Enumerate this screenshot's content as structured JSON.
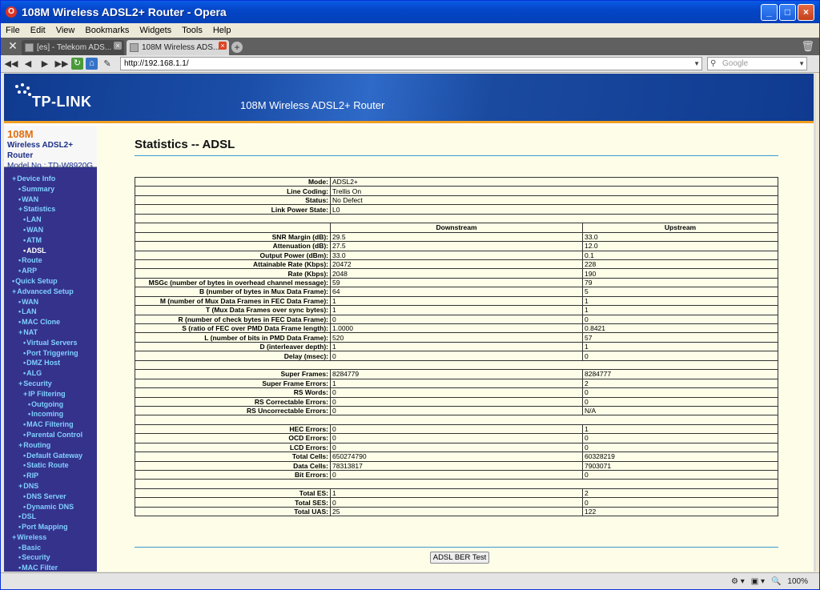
{
  "window": {
    "title": "108M Wireless ADSL2+ Router - Opera",
    "controls": [
      "_",
      "□",
      "×"
    ]
  },
  "menubar": [
    "File",
    "Edit",
    "View",
    "Bookmarks",
    "Widgets",
    "Tools",
    "Help"
  ],
  "tabs": [
    {
      "label": "[es] - Telekom ADS..."
    },
    {
      "label": "108M Wireless ADS..."
    }
  ],
  "address": {
    "url": "http://192.168.1.1/",
    "search_placeholder": "Google"
  },
  "banner": {
    "logo": "TP-LINK",
    "title": "108M Wireless ADSL2+ Router"
  },
  "model": {
    "line1": "108M",
    "line2": "Wireless ADSL2+ Router",
    "line3": "Model No.: TD-W8920G"
  },
  "menu": [
    {
      "label": "Device Info",
      "level": 0,
      "bullet": "+"
    },
    {
      "label": "Summary",
      "level": 1,
      "bullet": "•"
    },
    {
      "label": "WAN",
      "level": 1,
      "bullet": "•"
    },
    {
      "label": "Statistics",
      "level": 1,
      "bullet": "+"
    },
    {
      "label": "LAN",
      "level": 2,
      "bullet": "•"
    },
    {
      "label": "WAN",
      "level": 2,
      "bullet": "•"
    },
    {
      "label": "ATM",
      "level": 2,
      "bullet": "•"
    },
    {
      "label": "ADSL",
      "level": 2,
      "bullet": "•",
      "active": true
    },
    {
      "label": "Route",
      "level": 1,
      "bullet": "•"
    },
    {
      "label": "ARP",
      "level": 1,
      "bullet": "•"
    },
    {
      "label": "Quick Setup",
      "level": 0,
      "bullet": "•"
    },
    {
      "label": "Advanced Setup",
      "level": 0,
      "bullet": "+"
    },
    {
      "label": "WAN",
      "level": 1,
      "bullet": "•"
    },
    {
      "label": "LAN",
      "level": 1,
      "bullet": "•"
    },
    {
      "label": "MAC Clone",
      "level": 1,
      "bullet": "•"
    },
    {
      "label": "NAT",
      "level": 1,
      "bullet": "+"
    },
    {
      "label": "Virtual Servers",
      "level": 2,
      "bullet": "•"
    },
    {
      "label": "Port Triggering",
      "level": 2,
      "bullet": "•"
    },
    {
      "label": "DMZ Host",
      "level": 2,
      "bullet": "•"
    },
    {
      "label": "ALG",
      "level": 2,
      "bullet": "•"
    },
    {
      "label": "Security",
      "level": 1,
      "bullet": "+"
    },
    {
      "label": "IP Filtering",
      "level": 2,
      "bullet": "+"
    },
    {
      "label": "Outgoing",
      "level": 3,
      "bullet": "•"
    },
    {
      "label": "Incoming",
      "level": 3,
      "bullet": "•"
    },
    {
      "label": "MAC Filtering",
      "level": 2,
      "bullet": "•"
    },
    {
      "label": "Parental Control",
      "level": 2,
      "bullet": "•"
    },
    {
      "label": "Routing",
      "level": 1,
      "bullet": "+"
    },
    {
      "label": "Default Gateway",
      "level": 2,
      "bullet": "•"
    },
    {
      "label": "Static Route",
      "level": 2,
      "bullet": "•"
    },
    {
      "label": "RIP",
      "level": 2,
      "bullet": "•"
    },
    {
      "label": "DNS",
      "level": 1,
      "bullet": "+"
    },
    {
      "label": "DNS Server",
      "level": 2,
      "bullet": "•"
    },
    {
      "label": "Dynamic DNS",
      "level": 2,
      "bullet": "•"
    },
    {
      "label": "DSL",
      "level": 1,
      "bullet": "•"
    },
    {
      "label": "Port Mapping",
      "level": 1,
      "bullet": "•"
    },
    {
      "label": "Wireless",
      "level": 0,
      "bullet": "+"
    },
    {
      "label": "Basic",
      "level": 1,
      "bullet": "•"
    },
    {
      "label": "Security",
      "level": 1,
      "bullet": "•"
    },
    {
      "label": "MAC Filter",
      "level": 1,
      "bullet": "•"
    }
  ],
  "page": {
    "title": "Statistics -- ADSL",
    "ber_button": "ADSL BER Test"
  },
  "stats": {
    "info": [
      [
        "Mode:",
        "ADSL2+"
      ],
      [
        "Line Coding:",
        "Trellis On"
      ],
      [
        "Status:",
        "No Defect"
      ],
      [
        "Link Power State:",
        "L0"
      ]
    ],
    "headers": [
      "Downstream",
      "Upstream"
    ],
    "groups": [
      [
        [
          "SNR Margin (dB):",
          "29.5",
          "33.0"
        ],
        [
          "Attenuation (dB):",
          "27.5",
          "12.0"
        ],
        [
          "Output Power (dBm):",
          "33.0",
          "0.1"
        ],
        [
          "Attainable Rate (Kbps):",
          "20472",
          "228"
        ],
        [
          "Rate (Kbps):",
          "2048",
          "190"
        ],
        [
          "MSGc (number of bytes in overhead channel message):",
          "59",
          "79"
        ],
        [
          "B (number of bytes in Mux Data Frame):",
          "64",
          "5"
        ],
        [
          "M (number of Mux Data Frames in FEC Data Frame):",
          "1",
          "1"
        ],
        [
          "T (Mux Data Frames over sync bytes):",
          "1",
          "1"
        ],
        [
          "R (number of check bytes in FEC Data Frame):",
          "0",
          "0"
        ],
        [
          "S (ratio of FEC over PMD Data Frame length):",
          "1.0000",
          "0.8421"
        ],
        [
          "L (number of bits in PMD Data Frame):",
          "520",
          "57"
        ],
        [
          "D (interleaver depth):",
          "1",
          "1"
        ],
        [
          "Delay (msec):",
          "0",
          "0"
        ]
      ],
      [
        [
          "Super Frames:",
          "8284779",
          "8284777"
        ],
        [
          "Super Frame Errors:",
          "1",
          "2"
        ],
        [
          "RS Words:",
          "0",
          "0"
        ],
        [
          "RS Correctable Errors:",
          "0",
          "0"
        ],
        [
          "RS Uncorrectable Errors:",
          "0",
          "N/A"
        ]
      ],
      [
        [
          "HEC Errors:",
          "0",
          "1"
        ],
        [
          "OCD Errors:",
          "0",
          "0"
        ],
        [
          "LCD Errors:",
          "0",
          "0"
        ],
        [
          "Total Cells:",
          "650274790",
          "60328219"
        ],
        [
          "Data Cells:",
          "78313817",
          "7903071"
        ],
        [
          "Bit Errors:",
          "0",
          "0"
        ]
      ],
      [
        [
          "Total ES:",
          "1",
          "2"
        ],
        [
          "Total SES:",
          "0",
          "0"
        ],
        [
          "Total UAS:",
          "25",
          "122"
        ]
      ]
    ]
  },
  "statusbar": {
    "zoom": "100%"
  }
}
